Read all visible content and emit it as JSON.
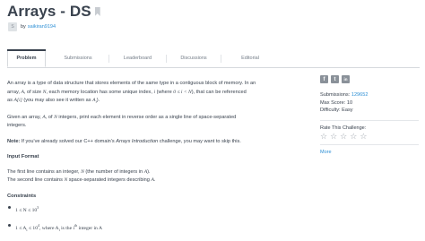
{
  "header": {
    "title": "Arrays - DS",
    "author_by": "by",
    "author_name": "saikiran9194",
    "avatar_text": "S"
  },
  "tabs": [
    {
      "label": "Problem",
      "active": true
    },
    {
      "label": "Submissions",
      "active": false
    },
    {
      "label": "Leaderboard",
      "active": false
    },
    {
      "label": "Discussions",
      "active": false
    },
    {
      "label": "Editorial",
      "active": false
    }
  ],
  "problem": {
    "intro_1": "An array is a type of data structure that stores elements of the same type in a contiguous block of memory. In an",
    "intro_2a": "array, ",
    "intro_2b": ", of size ",
    "intro_2c": ", each memory location has some unique index, ",
    "intro_2d": " (where ",
    "intro_2e": "), that can be referenced",
    "intro_3a": "as ",
    "intro_3b": " (you may also see it written as ",
    "intro_3c": ").",
    "var_A": "A",
    "var_N": "N",
    "var_i": "i",
    "cond_i": "0 ≤ i < N",
    "ref_1": "A[i]",
    "ref_2": "A",
    "ref_2_sub": "i",
    "given_a": "Given an array, ",
    "given_b": ", of ",
    "given_c": " integers, print each element in reverse order as a single line of space-separated",
    "given_d": "integers.",
    "note_label": "Note:",
    "note_text_a": " If you've already solved our C++ domain's ",
    "note_text_b": "Arrays Introduction",
    "note_text_c": " challenge, you may want to skip this.",
    "input_heading": "Input Format",
    "input_1a": "The first line contains an integer, ",
    "input_1b": " (the number of integers in ",
    "input_1c": ").",
    "input_2a": "The second line contains ",
    "input_2b": " space-separated integers describing ",
    "input_2c": ".",
    "constraints_heading": "Constraints",
    "c1": "1 ≤ N ≤ 10",
    "c1_exp": "3",
    "c2": "1 ≤ A",
    "c2_sub": "i",
    "c2_mid": " ≤ 10",
    "c2_exp": "4",
    "c2_tail_a": ", where A",
    "c2_tail_sub": "i",
    "c2_tail_b": " is the i",
    "c2_tail_exp": "th",
    "c2_tail_c": " integer in A"
  },
  "sidebar": {
    "share_icons": [
      "facebook-icon",
      "twitter-icon",
      "linkedin-icon"
    ],
    "share_glyphs": [
      "f",
      "t",
      "in"
    ],
    "submissions_label": "Submissions: ",
    "submissions_value": "129652",
    "max_score": "Max Score: 10",
    "difficulty": "Difficulty: Easy",
    "rate_label": "Rate This Challenge:",
    "stars": [
      "☆",
      "☆",
      "☆",
      "☆",
      "☆"
    ],
    "more": "More"
  }
}
